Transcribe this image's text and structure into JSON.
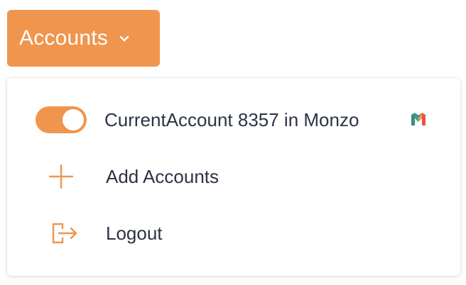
{
  "header": {
    "accounts_button_label": "Accounts"
  },
  "menu": {
    "account_item": {
      "label": "CurrentAccount 8357 in Monzo",
      "toggle_on": true,
      "bank_logo": "monzo-logo"
    },
    "add_accounts": {
      "label": "Add Accounts",
      "icon": "plus-icon"
    },
    "logout": {
      "label": "Logout",
      "icon": "logout-icon"
    }
  },
  "colors": {
    "accent": "#f0954e",
    "text": "#2c3344",
    "background": "#ffffff"
  }
}
